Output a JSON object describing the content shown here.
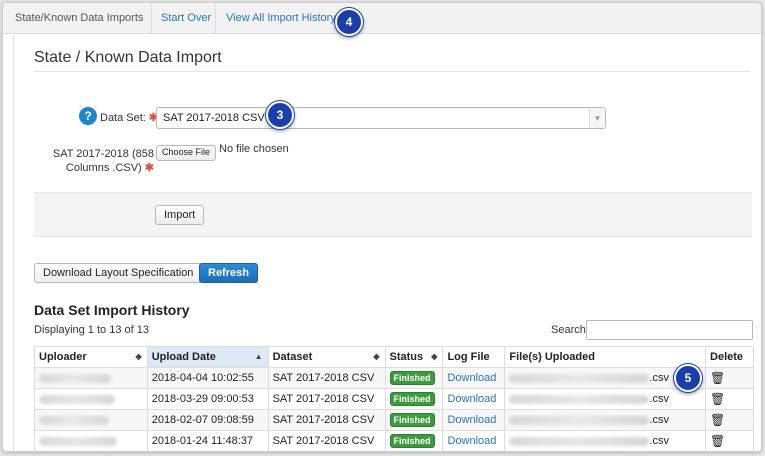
{
  "nav": {
    "brand": "State/Known Data Imports",
    "start_over": "Start Over",
    "view_all": "View All Import History"
  },
  "badges": {
    "b3": "3",
    "b4": "4",
    "b5": "5"
  },
  "page": {
    "title": "State / Known Data Import"
  },
  "form": {
    "dataset_label": "Data Set:",
    "dataset_value": "SAT 2017-2018 CSV",
    "file_label_1": "SAT 2017-2018 (858",
    "file_label_2": "Columns .CSV)",
    "choose_file": "Choose File",
    "no_file": "No file chosen",
    "import": "Import"
  },
  "actions": {
    "download_layout": "Download Layout Specification",
    "refresh": "Refresh"
  },
  "history": {
    "title": "Data Set Import History",
    "displaying": "Displaying 1 to 13 of 13",
    "search_label": "Search",
    "columns": [
      "Uploader",
      "Upload Date",
      "Dataset",
      "Status",
      "Log File",
      "File(s) Uploaded",
      "Delete"
    ],
    "rows": [
      {
        "date": "2018-04-04 10:02:55",
        "dataset": "SAT 2017-2018 CSV",
        "status": "Finished",
        "log": "Download",
        "file_ext": ".csv"
      },
      {
        "date": "2018-03-29 09:00:53",
        "dataset": "SAT 2017-2018 CSV",
        "status": "Finished",
        "log": "Download",
        "file_ext": ".csv"
      },
      {
        "date": "2018-02-07 09:08:59",
        "dataset": "SAT 2017-2018 CSV",
        "status": "Finished",
        "log": "Download",
        "file_ext": ".csv"
      },
      {
        "date": "2018-01-24 11:48:37",
        "dataset": "SAT 2017-2018 CSV",
        "status": "Finished",
        "log": "Download",
        "file_ext": ".csv"
      }
    ]
  },
  "icons": {
    "help": "question-circle-icon",
    "required": "asterisk-icon",
    "sort": "sort-icon",
    "delete": "trash-icon"
  },
  "colors": {
    "accent": "#1f86c8",
    "badge": "#1a3fa8",
    "status_finished": "#3e9a3e",
    "required": "#d9534f"
  }
}
